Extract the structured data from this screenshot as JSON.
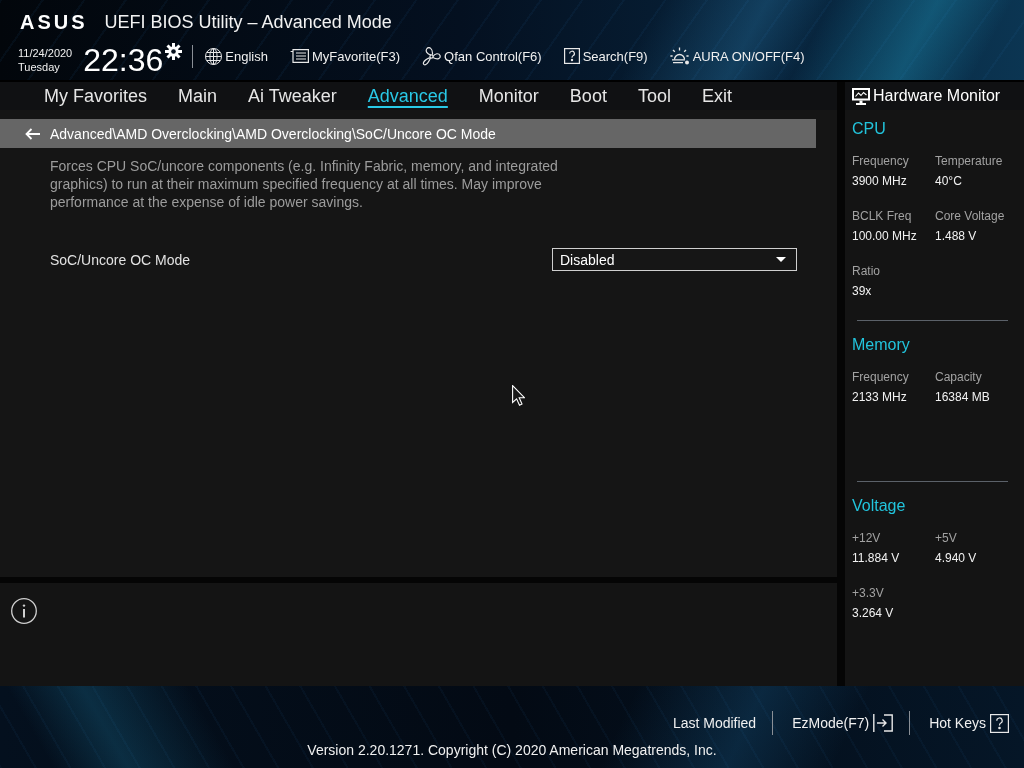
{
  "header": {
    "logo": "ASUS",
    "title": "UEFI BIOS Utility – Advanced Mode",
    "date": "11/24/2020",
    "day": "Tuesday",
    "time": "22:36",
    "tools": [
      {
        "kind": "language",
        "label": "English"
      },
      {
        "kind": "favorite",
        "label": "MyFavorite(F3)"
      },
      {
        "kind": "fan",
        "label": "Qfan Control(F6)"
      },
      {
        "kind": "search",
        "label": "Search(F9)"
      },
      {
        "kind": "aura",
        "label": "AURA ON/OFF(F4)"
      }
    ]
  },
  "tabs": [
    {
      "label": "My Favorites",
      "selected": false
    },
    {
      "label": "Main",
      "selected": false
    },
    {
      "label": "Ai Tweaker",
      "selected": false
    },
    {
      "label": "Advanced",
      "selected": true
    },
    {
      "label": "Monitor",
      "selected": false
    },
    {
      "label": "Boot",
      "selected": false
    },
    {
      "label": "Tool",
      "selected": false
    },
    {
      "label": "Exit",
      "selected": false
    }
  ],
  "breadcrumb": "Advanced\\AMD Overclocking\\AMD Overclocking\\SoC/Uncore OC Mode",
  "description": "Forces CPU SoC/uncore components (e.g. Infinity Fabric, memory, and integrated graphics) to run at their maximum specified frequency at all times. May improve performance at the expense of idle power savings.",
  "settings": [
    {
      "label": "SoC/Uncore OC Mode",
      "value": "Disabled"
    }
  ],
  "hardware_monitor": {
    "title": "Hardware Monitor",
    "sections": [
      {
        "title": "CPU",
        "readings": [
          {
            "label": "Frequency",
            "value": "3900 MHz"
          },
          {
            "label": "Temperature",
            "value": "40°C"
          },
          {
            "label": "BCLK Freq",
            "value": "100.00 MHz"
          },
          {
            "label": "Core Voltage",
            "value": "1.488 V"
          },
          {
            "label": "Ratio",
            "value": "39x"
          }
        ]
      },
      {
        "title": "Memory",
        "readings": [
          {
            "label": "Frequency",
            "value": "2133 MHz"
          },
          {
            "label": "Capacity",
            "value": "16384 MB"
          }
        ]
      },
      {
        "title": "Voltage",
        "readings": [
          {
            "label": "+12V",
            "value": "11.884 V"
          },
          {
            "label": "+5V",
            "value": "4.940 V"
          },
          {
            "label": "+3.3V",
            "value": "3.264 V"
          }
        ]
      }
    ]
  },
  "footer": {
    "actions": [
      {
        "kind": "last_modified",
        "label": "Last Modified"
      },
      {
        "kind": "ezmode",
        "label": "EzMode(F7)"
      },
      {
        "kind": "hotkeys",
        "label": "Hot Keys"
      }
    ],
    "version": "Version 2.20.1271. Copyright (C) 2020 American Megatrends, Inc."
  }
}
